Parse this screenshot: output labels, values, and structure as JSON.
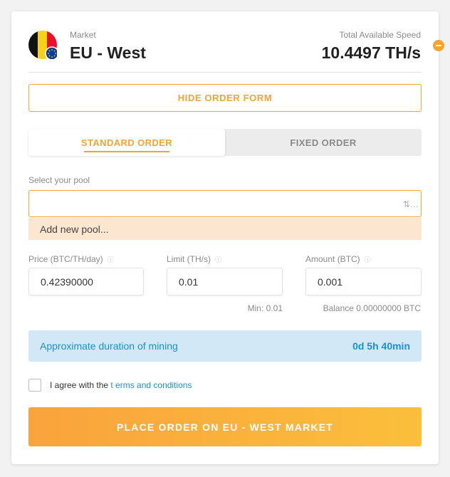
{
  "market": {
    "label": "Market",
    "name": "EU - West",
    "flag_colors": [
      "#111111",
      "#f7d117",
      "#e8112d"
    ],
    "eu_color": "#0d3b9a"
  },
  "speed": {
    "label": "Total Available Speed",
    "value": "10.4497 TH/s"
  },
  "hide_form_label": "HIDE ORDER FORM",
  "tabs": [
    {
      "label": "STANDARD ORDER",
      "active": true
    },
    {
      "label": "FIXED ORDER",
      "active": false
    }
  ],
  "pool": {
    "label": "Select your pool",
    "value": "",
    "icon": "selector-icon",
    "options": [
      "Add new pool..."
    ]
  },
  "fields": {
    "price": {
      "label": "Price (BTC/TH/day)",
      "value": "0.42390000"
    },
    "limit": {
      "label": "Limit (TH/s)",
      "value": "0.01",
      "hint": "Min: 0.01"
    },
    "amount": {
      "label": "Amount (BTC)",
      "value": "0.001",
      "hint": "Balance 0.00000000 BTC"
    }
  },
  "duration": {
    "label": "Approximate duration of mining",
    "value": "0d 5h 40min"
  },
  "terms": {
    "prefix": "I agree with the ",
    "link": "t erms and conditions",
    "checked": false
  },
  "place_order_label": "PLACE ORDER ON EU - WEST MARKET",
  "colors": {
    "accent": "#f5a433",
    "info": "#1c8fd4",
    "info_bg": "#d3e8f6"
  }
}
